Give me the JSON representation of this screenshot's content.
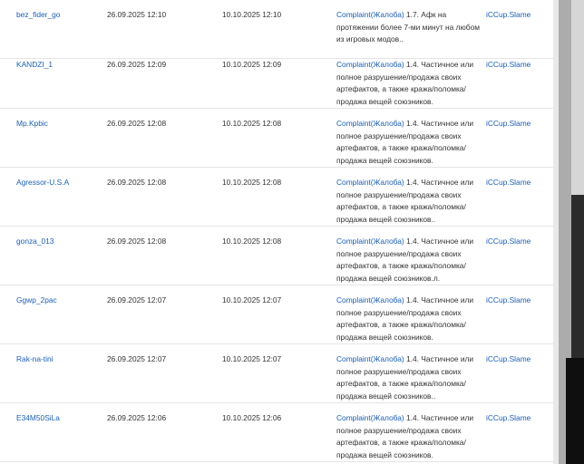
{
  "rows": [
    {
      "user": "bez_fider_go",
      "banned": "26.09.2025 12:10",
      "until": "10.10.2025 12:10",
      "reason_link": "Complaint(Жалоба)",
      "reason_text": " 1.7. Афк на протяжении более 7-ми минут на любом из игровых модов..",
      "admin": "iCCup.Slame"
    },
    {
      "user": "KANDZI_1",
      "banned": "26.09.2025 12:09",
      "until": "10.10.2025 12:09",
      "reason_link": "Complaint(Жалоба)",
      "reason_text": " 1.4. Частичное или полное разрушение/продажа своих артефактов, а также кража/поломка/продажа вещей союзников.",
      "admin": "iCCup.Slame"
    },
    {
      "user": "Mp.Kpbic",
      "banned": "26.09.2025 12:08",
      "until": "10.10.2025 12:08",
      "reason_link": "Complaint(Жалоба)",
      "reason_text": " 1.4. Частичное или полное разрушение/продажа своих артефактов, а также кража/поломка/продажа вещей союзников.",
      "admin": "iCCup.Slame"
    },
    {
      "user": "Agressor-U.S.A",
      "banned": "26.09.2025 12:08",
      "until": "10.10.2025 12:08",
      "reason_link": "Complaint(Жалоба)",
      "reason_text": " 1.4. Частичное или полное разрушение/продажа своих артефактов, а также кража/поломка/продажа вещей союзников..",
      "admin": "iCCup.Slame"
    },
    {
      "user": "gonza_013",
      "banned": "26.09.2025 12:08",
      "until": "10.10.2025 12:08",
      "reason_link": "Complaint(Жалоба)",
      "reason_text": " 1.4. Частичное или полное разрушение/продажа своих артефактов, а также кража/поломка/продажа вещей союзников.л.",
      "admin": "iCCup.Slame"
    },
    {
      "user": "Ggwp_2pac",
      "banned": "26.09.2025 12:07",
      "until": "10.10.2025 12:07",
      "reason_link": "Complaint(Жалоба)",
      "reason_text": " 1.4. Частичное или полное разрушение/продажа своих артефактов, а также кража/поломка/продажа вещей союзников.",
      "admin": "iCCup.Slame"
    },
    {
      "user": "Rak-na-tini",
      "banned": "26.09.2025 12:07",
      "until": "10.10.2025 12:07",
      "reason_link": "Complaint(Жалоба)",
      "reason_text": " 1.4. Частичное или полное разрушение/продажа своих артефактов, а также кража/поломка/продажа вещей союзников..",
      "admin": "iCCup.Slame"
    },
    {
      "user": "E34M50SiLa",
      "banned": "26.09.2025 12:06",
      "until": "10.10.2025 12:06",
      "reason_link": "Complaint(Жалоба)",
      "reason_text": " 1.4. Частичное или полное разрушение/продажа своих артефактов, а также кража/поломка/продажа вещей союзников.",
      "admin": "iCCup.Slame"
    }
  ]
}
